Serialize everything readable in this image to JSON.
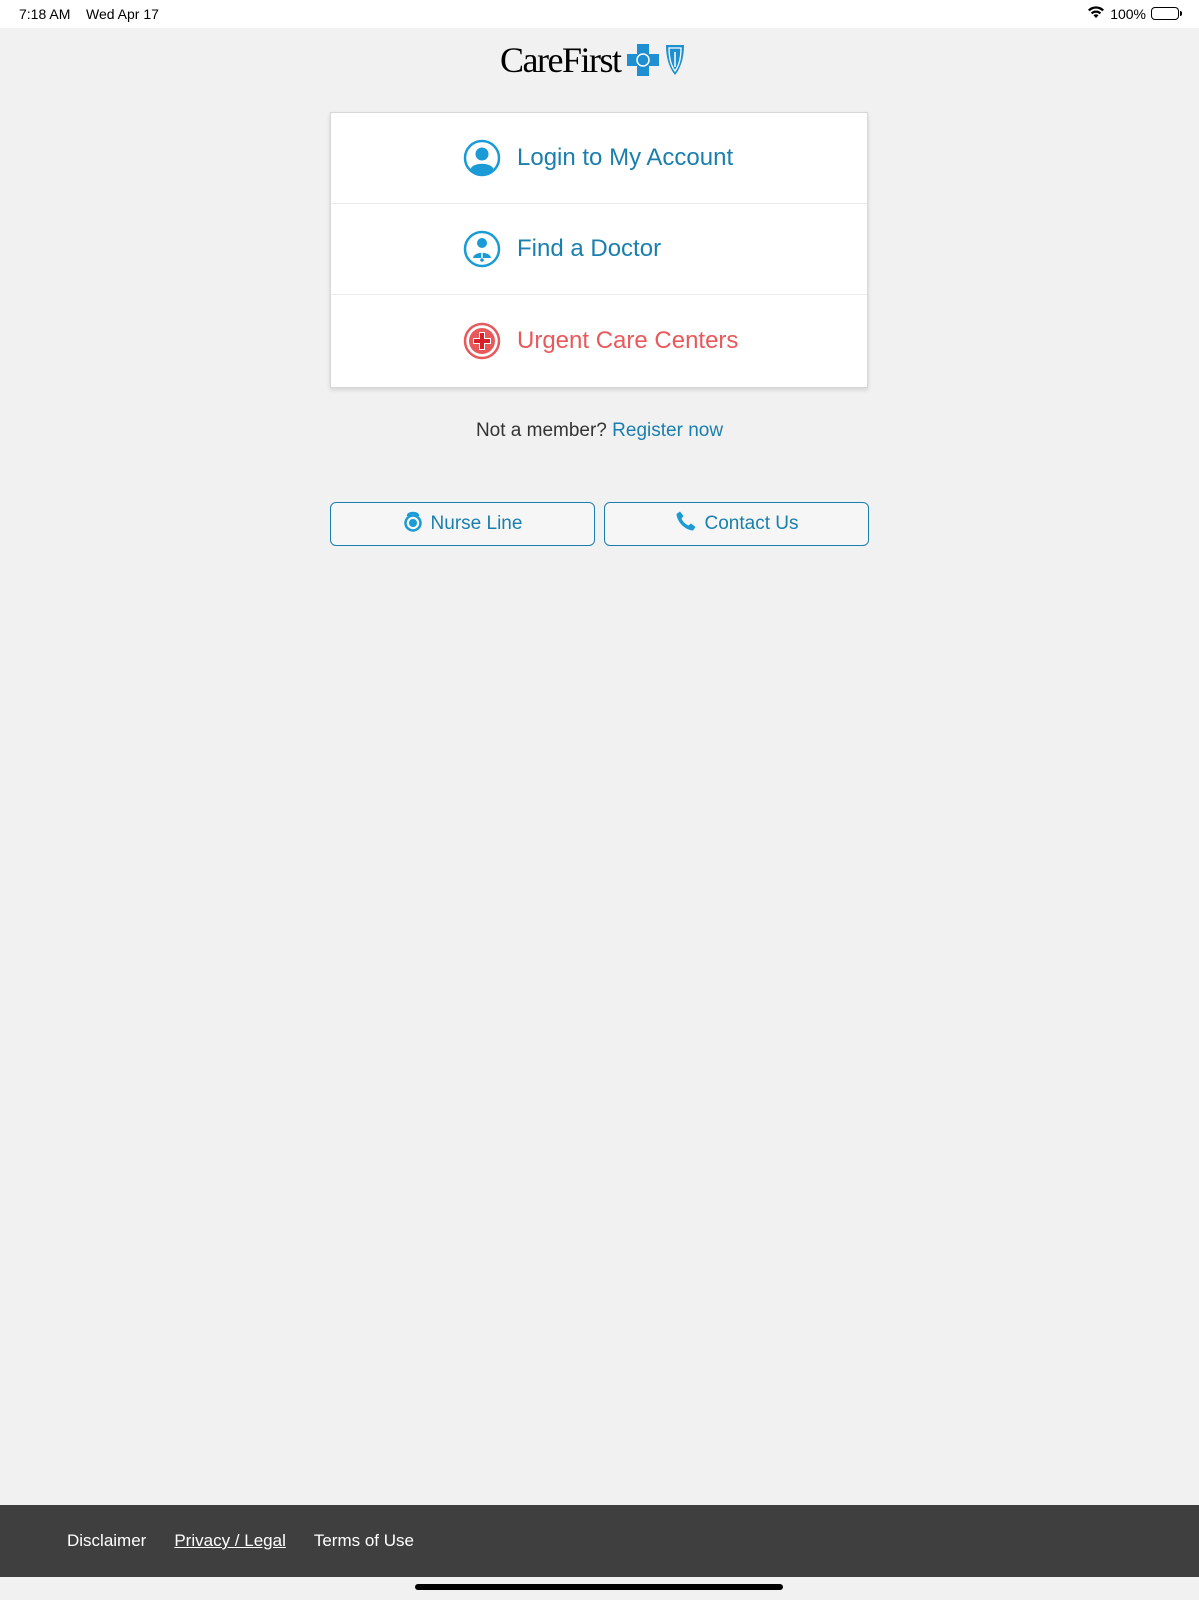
{
  "status_bar": {
    "time": "7:18 AM",
    "date": "Wed Apr 17",
    "battery": "100%"
  },
  "logo": {
    "text": "CareFirst"
  },
  "menu": {
    "items": [
      {
        "label": "Login to My Account",
        "icon": "user-icon"
      },
      {
        "label": "Find a Doctor",
        "icon": "doctor-icon"
      },
      {
        "label": "Urgent Care Centers",
        "icon": "medical-cross-icon"
      }
    ]
  },
  "register": {
    "prompt": "Not a member?",
    "link": "Register now"
  },
  "buttons": {
    "nurse_line": "Nurse Line",
    "contact_us": "Contact Us"
  },
  "footer": {
    "disclaimer": "Disclaimer",
    "privacy": "Privacy / Legal",
    "terms": "Terms of Use"
  },
  "colors": {
    "accent": "#1a7fae",
    "urgent": "#e8595c",
    "footer_bg": "#3f3f3f",
    "background": "#f1f1f1"
  }
}
